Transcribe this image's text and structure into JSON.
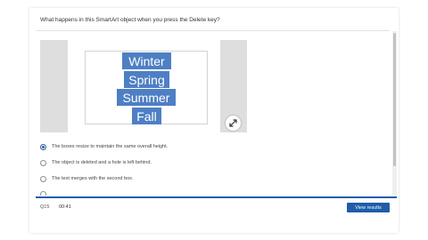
{
  "question": {
    "text": "What happens in this SmartArt object when you press the Delete key?"
  },
  "smartart": {
    "items": [
      "Winter",
      "Spring",
      "Summer",
      "Fall"
    ],
    "box_color": "#4e7fc4"
  },
  "expand_icon": "expand-arrows-icon",
  "answers": [
    {
      "label": "The boxes resize to maintain the same overall height.",
      "selected": true
    },
    {
      "label": "The object is deleted and a hole is left behind.",
      "selected": false
    },
    {
      "label": "The text merges with the second box.",
      "selected": false
    }
  ],
  "footer": {
    "question_number": "Q15",
    "timer": "00:41",
    "view_results_label": "View results"
  },
  "colors": {
    "accent": "#1f5da8",
    "selected_radio": "#2c5aa0"
  }
}
